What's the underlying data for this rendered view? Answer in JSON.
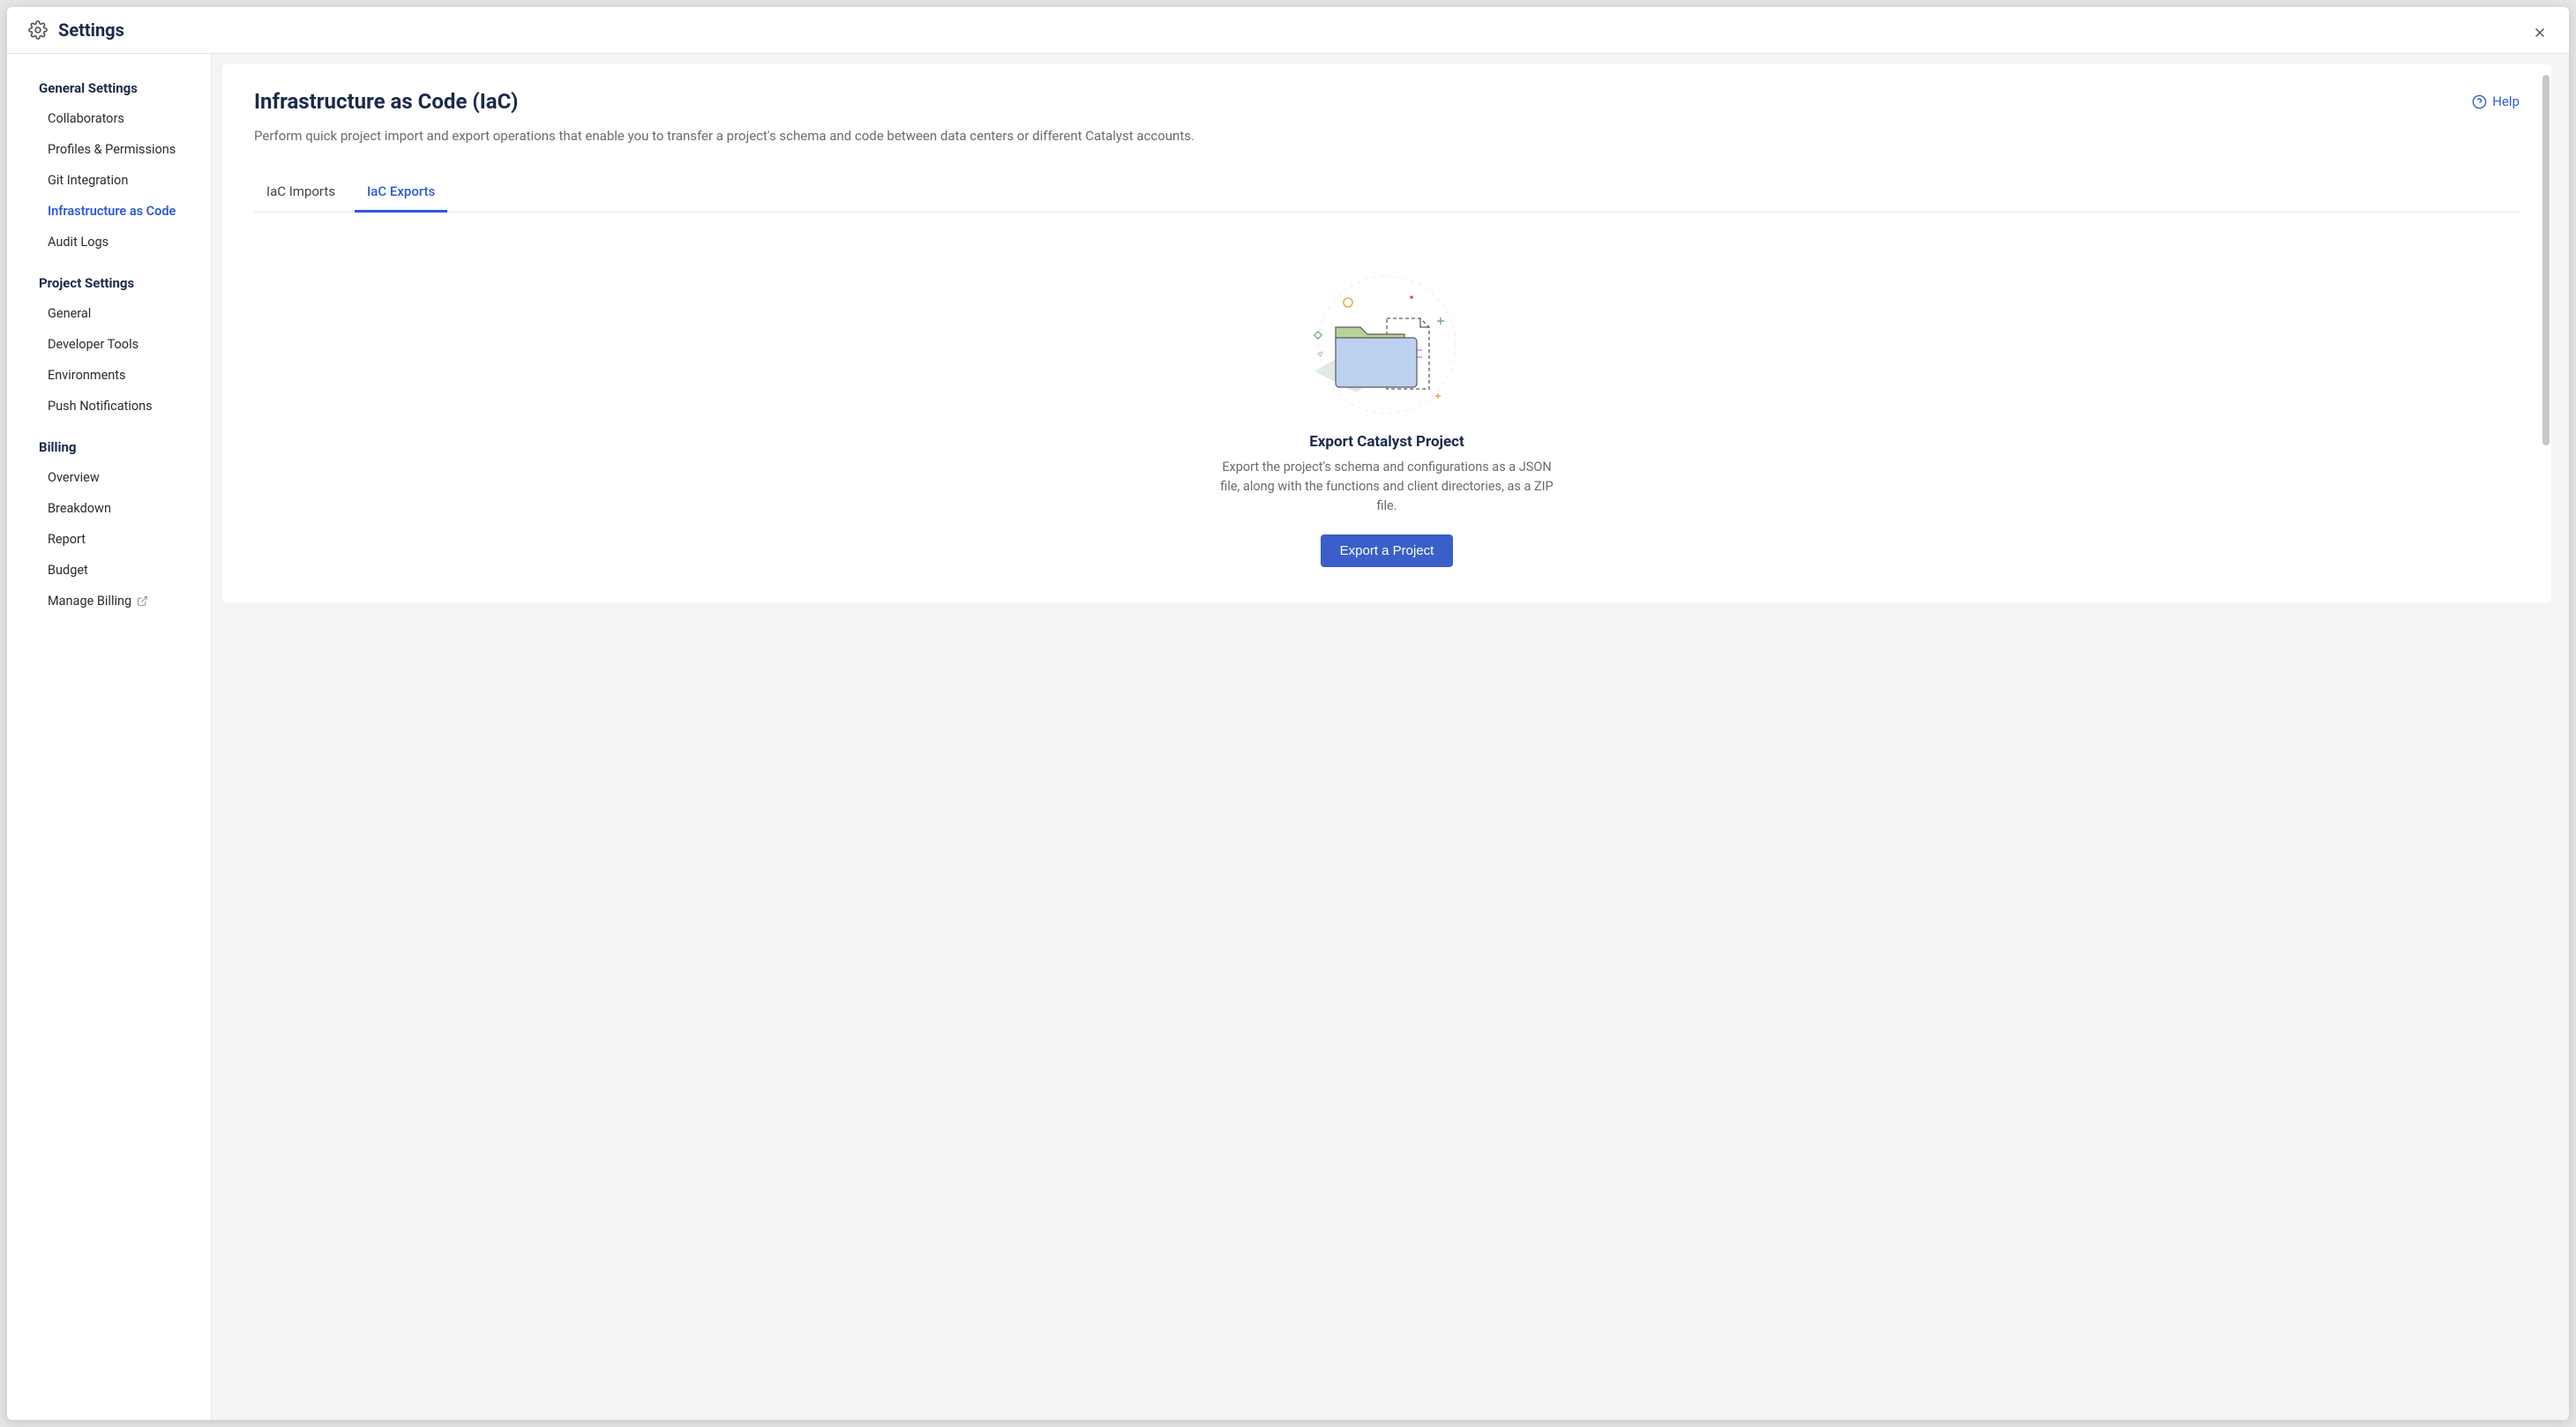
{
  "header": {
    "title": "Settings"
  },
  "sidebar": {
    "sections": [
      {
        "header": "General Settings",
        "items": [
          {
            "label": "Collaborators",
            "name": "collaborators"
          },
          {
            "label": "Profiles & Permissions",
            "name": "profiles-permissions"
          },
          {
            "label": "Git Integration",
            "name": "git-integration"
          },
          {
            "label": "Infrastructure as Code",
            "name": "infrastructure-as-code",
            "active": true
          },
          {
            "label": "Audit Logs",
            "name": "audit-logs"
          }
        ]
      },
      {
        "header": "Project Settings",
        "items": [
          {
            "label": "General",
            "name": "general"
          },
          {
            "label": "Developer Tools",
            "name": "developer-tools"
          },
          {
            "label": "Environments",
            "name": "environments"
          },
          {
            "label": "Push Notifications",
            "name": "push-notifications"
          }
        ]
      },
      {
        "header": "Billing",
        "items": [
          {
            "label": "Overview",
            "name": "overview"
          },
          {
            "label": "Breakdown",
            "name": "breakdown"
          },
          {
            "label": "Report",
            "name": "report"
          },
          {
            "label": "Budget",
            "name": "budget"
          },
          {
            "label": "Manage Billing",
            "name": "manage-billing",
            "external": true
          }
        ]
      }
    ]
  },
  "main": {
    "title": "Infrastructure as Code (IaC)",
    "description": "Perform quick project import and export operations that enable you to transfer a project's schema and code between data centers or different Catalyst accounts.",
    "help_label": "Help",
    "tabs": [
      {
        "label": "IaC Imports",
        "name": "iac-imports"
      },
      {
        "label": "IaC Exports",
        "name": "iac-exports",
        "active": true
      }
    ],
    "empty": {
      "title": "Export Catalyst Project",
      "description": "Export the project's schema and configurations as a JSON file, along with the functions and client directories, as a ZIP file.",
      "button": "Export a Project"
    }
  }
}
